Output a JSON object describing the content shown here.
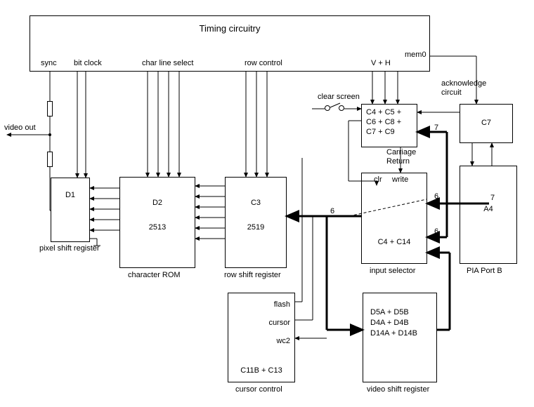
{
  "title": "Timing circuitry",
  "signals": {
    "sync": "sync",
    "bit_clock": "bit clock",
    "char_line_select": "char line select",
    "row_control": "row control",
    "vh": "V + H",
    "mem0": "mem0",
    "clear_screen": "clear screen",
    "carriage_return": "Carriage\nReturn",
    "clr": "clr",
    "write": "write",
    "flash": "flash",
    "cursor": "cursor",
    "wc2": "wc2",
    "video_out": "video out",
    "ack": "acknowledge\ncircuit"
  },
  "blocks": {
    "d1": {
      "id": "D1",
      "caption": "pixel shift register"
    },
    "d2": {
      "id": "D2",
      "chip": "2513",
      "caption": "character ROM"
    },
    "c3": {
      "id": "C3",
      "chip": "2519",
      "caption": "row shift register"
    },
    "counter": {
      "lines": [
        "C4 + C5 +",
        "C6 + C8 +",
        "C7 + C9"
      ]
    },
    "input_selector": {
      "id": "C4 + C14",
      "caption": "input selector"
    },
    "cursor_control": {
      "id": "C11B + C13",
      "caption": "cursor control"
    },
    "video_shift": {
      "lines": [
        "D5A + D5B",
        "D4A + D4B",
        "D14A + D14B"
      ],
      "caption": "video shift register"
    },
    "c7": {
      "id": "C7"
    },
    "a4": {
      "id": "A4",
      "caption": "PIA Port B"
    }
  },
  "bus_widths": {
    "six": "6",
    "seven": "7"
  }
}
